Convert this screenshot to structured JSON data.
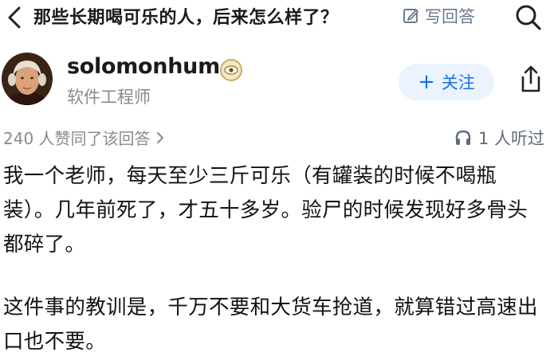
{
  "topbar": {
    "question_title": "那些长期喝可乐的人，后来怎么样了？",
    "write_answer_label": "写回答",
    "back_icon": "chevron-left-icon",
    "search_icon": "search-icon",
    "edit_icon": "edit-icon"
  },
  "author": {
    "name": "solomonhume",
    "role": "软件工程师",
    "badge_icon": "eye-badge-icon",
    "follow_label": "关注",
    "follow_prefix": "+",
    "share_icon": "share-icon"
  },
  "stats": {
    "upvote_text": "240 人赞同了该回答",
    "listen_text": "1 人听过"
  },
  "answer": {
    "paragraph_1": "我一个老师，每天至少三斤可乐（有罐装的时候不喝瓶装）。几年前死了，才五十多岁。验尸的时候发现好多骨头都碎了。",
    "paragraph_2": "这件事的教训是，千万不要和大货车抢道，就算错过高速出口也不要。"
  },
  "colors": {
    "accent": "#1771e6",
    "follow_bg": "#ebf3ff",
    "muted": "#8a8a8a",
    "text": "#121212"
  }
}
